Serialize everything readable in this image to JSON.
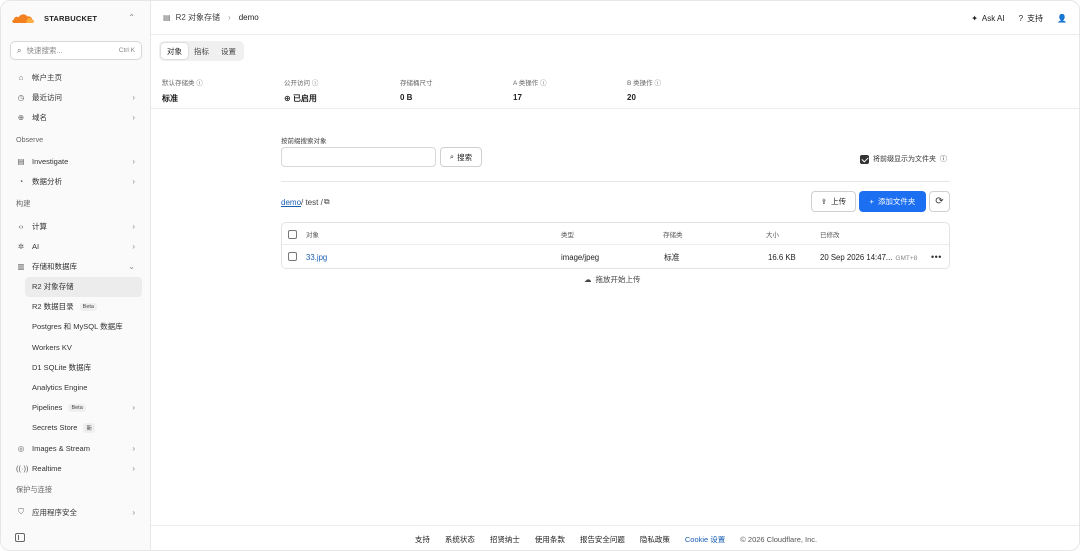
{
  "account": {
    "name": "STARBUCKET"
  },
  "search": {
    "placeholder": "快速搜索...",
    "shortcut": "Ctrl K"
  },
  "nav": {
    "home": "帐户主页",
    "recent": "最近访问",
    "domains": "域名",
    "section_observe": "Observe",
    "investigate": "Investigate",
    "analytics": "数据分析",
    "section_build": "构建",
    "compute": "计算",
    "ai": "AI",
    "storage": "存储和数据库",
    "sub": [
      {
        "label": "R2 对象存储"
      },
      {
        "label": "R2 数据目录",
        "badge": "Beta"
      },
      {
        "label": "Postgres 和 MySQL 数据库"
      },
      {
        "label": "Workers KV"
      },
      {
        "label": "D1 SQLite 数据库"
      },
      {
        "label": "Analytics Engine"
      },
      {
        "label": "Pipelines",
        "badge": "Beta"
      },
      {
        "label": "Secrets Store",
        "badge": "新"
      }
    ],
    "images": "Images & Stream",
    "realtime": "Realtime",
    "section_protect": "保护与连接",
    "appsec": "应用程序安全"
  },
  "topbar": {
    "breadcrumb_root": "R2 对象存储",
    "breadcrumb_current": "demo",
    "ask_ai": "Ask AI",
    "support": "支持"
  },
  "tabs": [
    "对象",
    "指标",
    "设置"
  ],
  "stats": [
    {
      "label": "默认存储类",
      "value": "标准",
      "info": true
    },
    {
      "label": "公开访问",
      "value": "已启用",
      "info": true,
      "globe": true
    },
    {
      "label": "存储桶尺寸",
      "value": "0 B",
      "info": false
    },
    {
      "label": "A 类操作",
      "value": "17",
      "info": true
    },
    {
      "label": "B 类操作",
      "value": "20",
      "info": true
    }
  ],
  "objects": {
    "prefix_label": "按前缀搜索对象",
    "prefix_value": "",
    "search_button": "搜索",
    "folder_toggle": "将前缀显示为文件夹",
    "path_root": "demo",
    "path_rest": " / test /",
    "upload_button": "上传",
    "add_folder_button": "添加文件夹",
    "columns": [
      "对象",
      "类型",
      "存储类",
      "大小",
      "已修改"
    ],
    "rows": [
      {
        "name": "33.jpg",
        "type": "image/jpeg",
        "storage": "标准",
        "size": "16.6 KB",
        "modified": "20 Sep 2026 14:47...",
        "tz": "GMT+8"
      }
    ],
    "drag_hint": "拖放开始上传"
  },
  "footer": {
    "links": [
      "支持",
      "系统状态",
      "招贤纳士",
      "使用条款",
      "报告安全问题",
      "隐私政策"
    ],
    "cookie": "Cookie 设置",
    "copyright": "© 2026 Cloudflare, Inc."
  },
  "colors": {
    "accent": "#1d6ff2",
    "link": "#1a5fb4",
    "logo": "#f38020"
  }
}
